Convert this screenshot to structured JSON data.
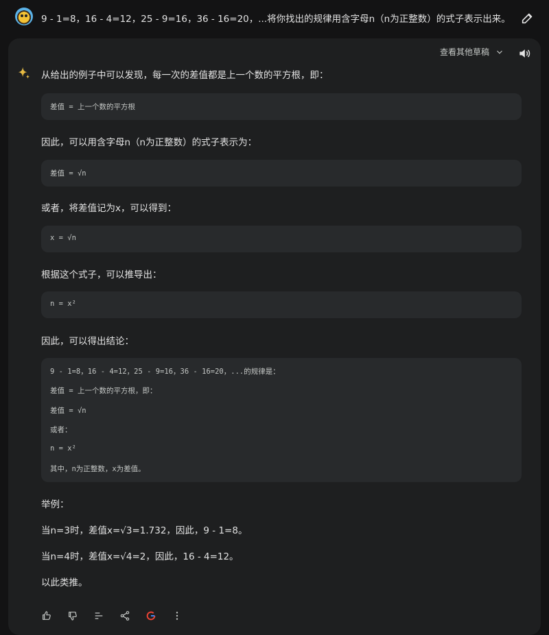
{
  "prompt": {
    "text": "9 - 1=8，16 - 4=12，25 - 9=16，36 - 16=20，...将你找出的规律用含字母n（n为正整数）的式子表示出来。"
  },
  "toolbar": {
    "drafts_label": "查看其他草稿"
  },
  "response": {
    "p1": "从给出的例子中可以发现，每一次的差值都是上一个数的平方根，即：",
    "code1": "差值 = 上一个数的平方根",
    "p2": "因此，可以用含字母n（n为正整数）的式子表示为：",
    "code2": "差值 = √n",
    "p3": "或者，将差值记为x，可以得到：",
    "code3": "x = √n",
    "p4": "根据这个式子，可以推导出：",
    "code4": "n = x²",
    "p5": "因此，可以得出结论：",
    "code5": [
      "9 - 1=8，16 - 4=12，25 - 9=16，36 - 16=20，...的规律是：",
      "差值 = 上一个数的平方根，即：",
      "差值 = √n",
      "或者：",
      "n = x²",
      "其中，n为正整数，x为差值。"
    ],
    "p6": "举例：",
    "p7": "当n=3时，差值x=√3=1.732，因此，9 - 1=8。",
    "p8": "当n=4时，差值x=√4=2，因此，16 - 4=12。",
    "p9": "以此类推。"
  },
  "icons": [
    "avatar",
    "edit-icon",
    "chevron-down-icon",
    "speaker-icon",
    "sparkle-icon",
    "thumb-up-icon",
    "thumb-down-icon",
    "modify-icon",
    "share-icon",
    "google-icon",
    "more-icon"
  ]
}
